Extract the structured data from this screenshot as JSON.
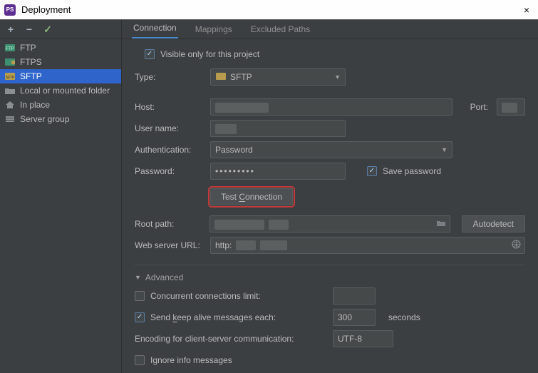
{
  "window": {
    "title": "Deployment",
    "close_label": "×",
    "logo_text": "PS"
  },
  "sidebar": {
    "toolbar": {
      "add": "+",
      "remove": "−",
      "apply": "✓"
    },
    "items": [
      {
        "key": "ftp",
        "label": "FTP",
        "icon": "ftp"
      },
      {
        "key": "ftps",
        "label": "FTPS",
        "icon": "ftps"
      },
      {
        "key": "sftp",
        "label": "SFTP",
        "icon": "sftp",
        "selected": true
      },
      {
        "key": "local",
        "label": "Local or mounted folder",
        "icon": "folder"
      },
      {
        "key": "inplace",
        "label": "In place",
        "icon": "home"
      },
      {
        "key": "group",
        "label": "Server group",
        "icon": "list"
      }
    ]
  },
  "tabs": [
    {
      "key": "connection",
      "label": "Connection",
      "active": true
    },
    {
      "key": "mappings",
      "label": "Mappings"
    },
    {
      "key": "excluded",
      "label": "Excluded Paths"
    }
  ],
  "form": {
    "visible_only": {
      "checked": true,
      "label": "Visible only for this project"
    },
    "type": {
      "label": "Type:",
      "value": "SFTP"
    },
    "host": {
      "label": "Host:",
      "value": ""
    },
    "port": {
      "label": "Port:",
      "value": ""
    },
    "user": {
      "label": "User name:",
      "value": ""
    },
    "auth": {
      "label": "Authentication:",
      "value": "Password"
    },
    "password": {
      "label": "Password:",
      "value": "•••••••••"
    },
    "save_password": {
      "checked": true,
      "label": "Save password"
    },
    "test_connection": "Test Connection",
    "root": {
      "label": "Root path:",
      "value": ""
    },
    "autodetect": "Autodetect",
    "web": {
      "label": "Web server URL:",
      "prefix": "http:"
    },
    "advanced": {
      "label": "Advanced",
      "concurrent": {
        "checked": false,
        "label": "Concurrent connections limit:",
        "value": ""
      },
      "keepalive": {
        "checked": true,
        "label_prefix": "Send ",
        "label_key": "k",
        "label_suffix": "eep alive messages each:",
        "value": "300",
        "unit": "seconds"
      },
      "encoding": {
        "label": "Encoding for client-server communication:",
        "value": "UTF-8"
      },
      "ignore": {
        "checked": false,
        "label": "Ignore info messages"
      }
    }
  }
}
